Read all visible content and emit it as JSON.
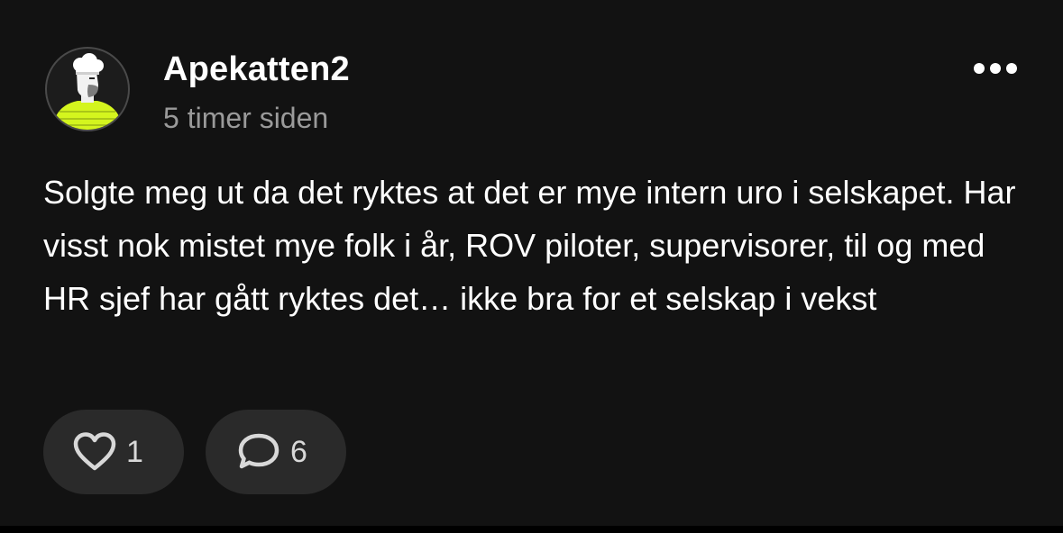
{
  "post": {
    "author": "Apekatten2",
    "timestamp": "5 timer siden",
    "body": "Solgte meg ut da det ryktes at det er mye intern uro i selskapet. Har visst nok mistet mye folk i år, ROV piloter, supervisorer, til og med HR sjef har gått ryktes det… ikke bra for et selskap i vekst",
    "likes": "1",
    "comments": "6"
  },
  "icons": {
    "avatar": "chef-avatar-icon",
    "more": "more-options-icon",
    "like": "heart-icon",
    "comment": "comment-bubble-icon"
  },
  "colors": {
    "background": "#121212",
    "text": "#ffffff",
    "muted": "#9a9a9a",
    "pill": "#2a2a2a",
    "avatar_accent": "#d4f51e"
  }
}
